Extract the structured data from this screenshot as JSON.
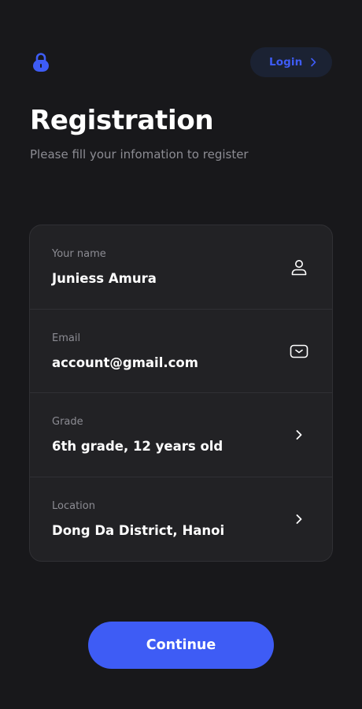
{
  "header": {
    "lock_icon": "lock-icon",
    "login_label": "Login",
    "login_icon": "chevron-right-icon"
  },
  "page": {
    "title": "Registration",
    "subtitle": "Please fill your infomation to register"
  },
  "form": {
    "fields": [
      {
        "label": "Your name",
        "value": "Juniess Amura",
        "icon": "user-icon"
      },
      {
        "label": "Email",
        "value": "account@gmail.com",
        "icon": "mail-icon"
      },
      {
        "label": "Grade",
        "value": "6th grade, 12 years old",
        "icon": "chevron-right-icon"
      },
      {
        "label": "Location",
        "value": "Dong Da District, Hanoi",
        "icon": "chevron-right-icon"
      }
    ]
  },
  "footer": {
    "continue_label": "Continue"
  },
  "colors": {
    "background": "#18181b",
    "card": "#222225",
    "accent": "#3e5cf5",
    "login_button_bg": "#1b2233",
    "label_gray": "#8c8c93",
    "text_white": "#ffffff"
  }
}
